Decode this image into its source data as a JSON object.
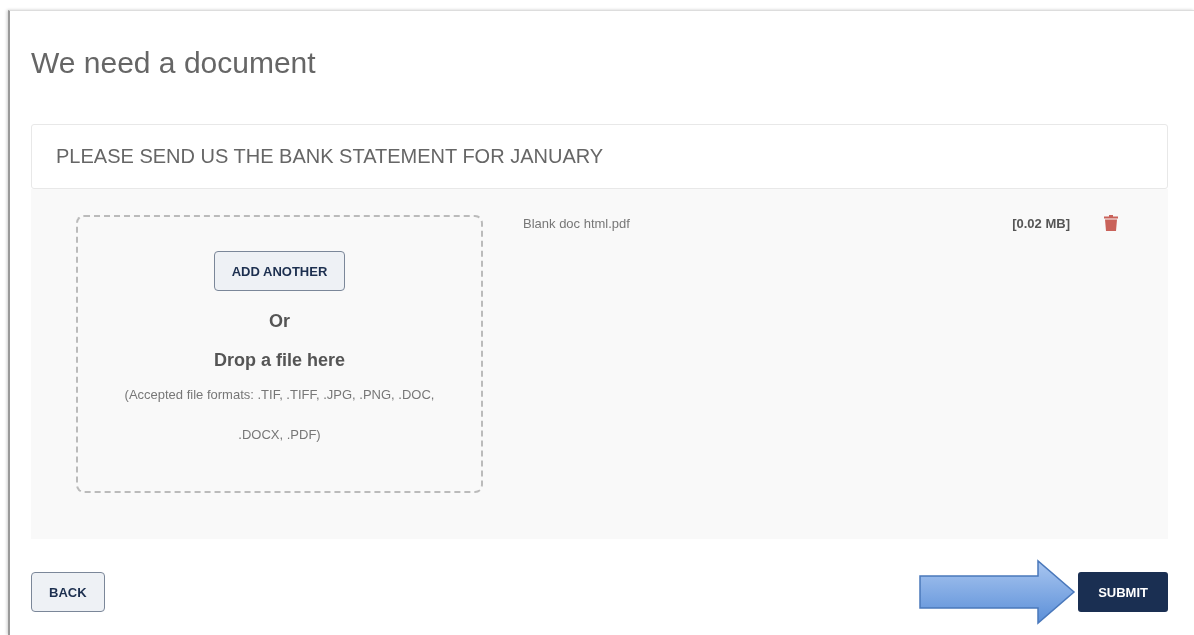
{
  "title": "We need a document",
  "request": "PLEASE SEND US THE BANK STATEMENT FOR JANUARY",
  "dropzone": {
    "button": "ADD ANOTHER",
    "or": "Or",
    "drop": "Drop a file here",
    "formats": "(Accepted file formats: .TIF, .TIFF, .JPG, .PNG, .DOC, .DOCX, .PDF)"
  },
  "files": [
    {
      "name": "Blank doc html.pdf",
      "size": "[0.02 MB]"
    }
  ],
  "back": "BACK",
  "submit": "SUBMIT"
}
